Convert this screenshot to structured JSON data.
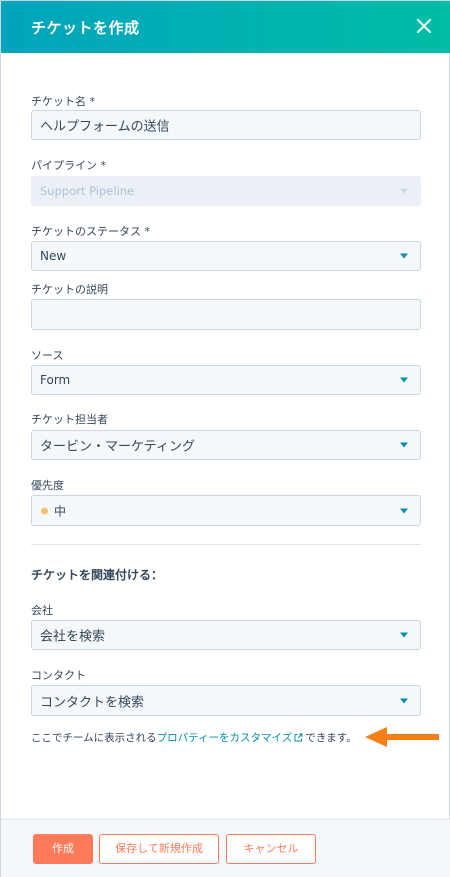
{
  "header": {
    "title": "チケットを作成",
    "close_icon": "close-icon"
  },
  "form": {
    "ticket_name": {
      "label": "チケット名 *",
      "value": "ヘルプフォームの送信"
    },
    "pipeline": {
      "label": "パイプライン *",
      "value": "Support Pipeline",
      "disabled": true
    },
    "status": {
      "label": "チケットのステータス *",
      "value": "New"
    },
    "description": {
      "label": "チケットの説明",
      "value": ""
    },
    "source": {
      "label": "ソース",
      "value": "Form"
    },
    "owner": {
      "label": "チケット担当者",
      "value": "タービン・マーケティング"
    },
    "priority": {
      "label": "優先度",
      "value": "中",
      "dot_color": "#f5c26b"
    }
  },
  "associate": {
    "title": "チケットを関連付ける：",
    "company": {
      "label": "会社",
      "placeholder": "会社を検索"
    },
    "contact": {
      "label": "コンタクト",
      "placeholder": "コンタクトを検索"
    }
  },
  "hint": {
    "prefix": "ここでチームに表示される",
    "link": "プロパティーをカスタマイズ",
    "link_icon": "external-link-icon",
    "suffix": "できます。",
    "arrow_icon": "arrow-left-icon",
    "arrow_color": "#f57f17"
  },
  "footer": {
    "create_label": "作成",
    "save_new_label": "保存して新規作成",
    "cancel_label": "キャンセル"
  },
  "colors": {
    "header_start": "#00a4bd",
    "header_end": "#00bda5",
    "accent": "#ff7a59",
    "link": "#0091ae"
  }
}
